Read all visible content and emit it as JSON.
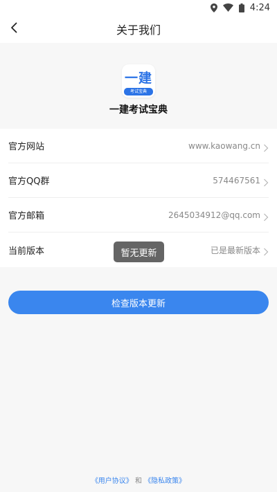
{
  "status_bar": {
    "time": "4:24",
    "icons": [
      "location-icon",
      "wifi-icon",
      "battery-icon"
    ]
  },
  "nav": {
    "back_icon": "chevron-left-icon",
    "title": "关于我们"
  },
  "app": {
    "logo_text": "一建",
    "logo_band": "考试宝典",
    "name": "一建考试宝典"
  },
  "info_rows": [
    {
      "label": "官方网站",
      "value": "www.kaowang.cn"
    },
    {
      "label": "官方QQ群",
      "value": "574467561"
    },
    {
      "label": "官方邮箱",
      "value": "2645034912@qq.com"
    },
    {
      "label": "当前版本",
      "value": "已是最新版本"
    }
  ],
  "toast": "暂无更新",
  "check_update_label": "检查版本更新",
  "footer": {
    "user_agreement": "《用户协议》",
    "conjunction": "和",
    "privacy_policy": "《隐私政策》"
  },
  "colors": {
    "accent": "#3a86ee",
    "background": "#f7f7f7",
    "card": "#ffffff",
    "secondary_text": "#888888"
  }
}
